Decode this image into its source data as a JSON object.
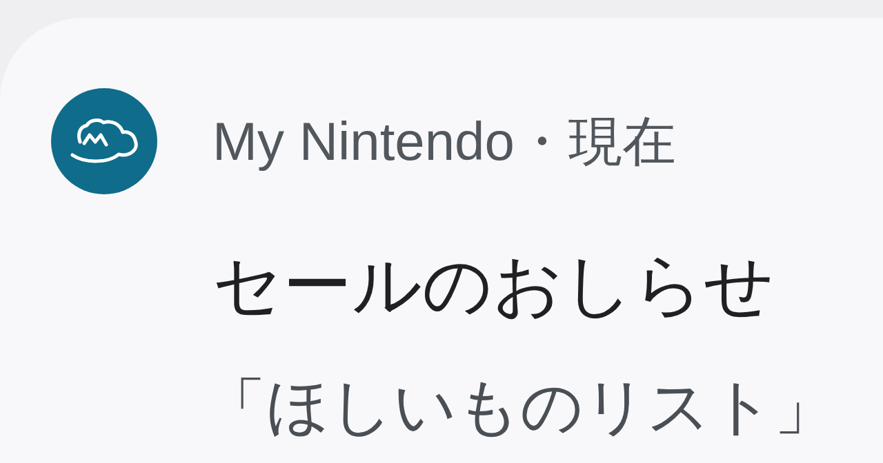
{
  "notification": {
    "app_name": "My Nintendo",
    "separator": "・",
    "time": "現在",
    "title": "セールのおしらせ",
    "body": "「ほしいものリスト」"
  }
}
